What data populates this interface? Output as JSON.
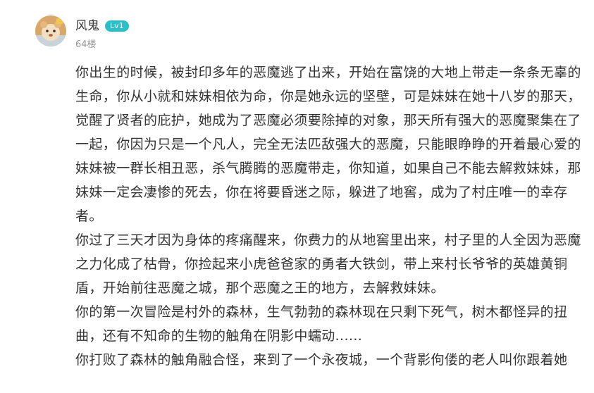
{
  "post": {
    "author_name": "风鬼",
    "level": "Lv1",
    "floor": "64楼"
  },
  "content": {
    "lines": [
      "你出生的时候，被封印多年的恶魔逃了出来，开始在富饶的大地上带走一条条无辜的",
      "生命，你从小就和妹妹相依为命，你是她永远的坚壁，可是妹妹在她十八岁的那天，",
      "觉醒了贤者的庇护，她成为了恶魔必须要除掉的对象，那天所有强大的恶魔聚集在了",
      "一起，你因为只是一个凡人，完全无法匹敌强大的恶魔，只能眼睁睁的开着最心爱的",
      "妹妹被一群长相丑恶，杀气腾腾的恶魔带走，你知道，如果自己不能去解救妹妹，那",
      "妹妹一定会凄惨的死去，你在将要昏迷之际，躲进了地窖，成为了村庄唯一的幸存",
      "者。",
      "你过了三天才因为身体的疼痛醒来，你费力的从地窖里出来，村子里的人全因为恶魔",
      "之力化成了枯骨，你捡起来小虎爸爸家的勇者大铁剑，带上来村长爷爷的英雄黄铜",
      "盾，开始前往恶魔之城，那个恶魔之王的地方，去解救妹妹。",
      "你的第一次冒险是村外的森林，生气勃勃的森林现在只剩下死气，树木都怪异的扭",
      "曲，还有不知命的生物的触角在阴影中蠕动......",
      "你打败了森林的触角融合怪，来到了一个永夜城，一个背影佝偻的老人叫你跟着她"
    ]
  }
}
